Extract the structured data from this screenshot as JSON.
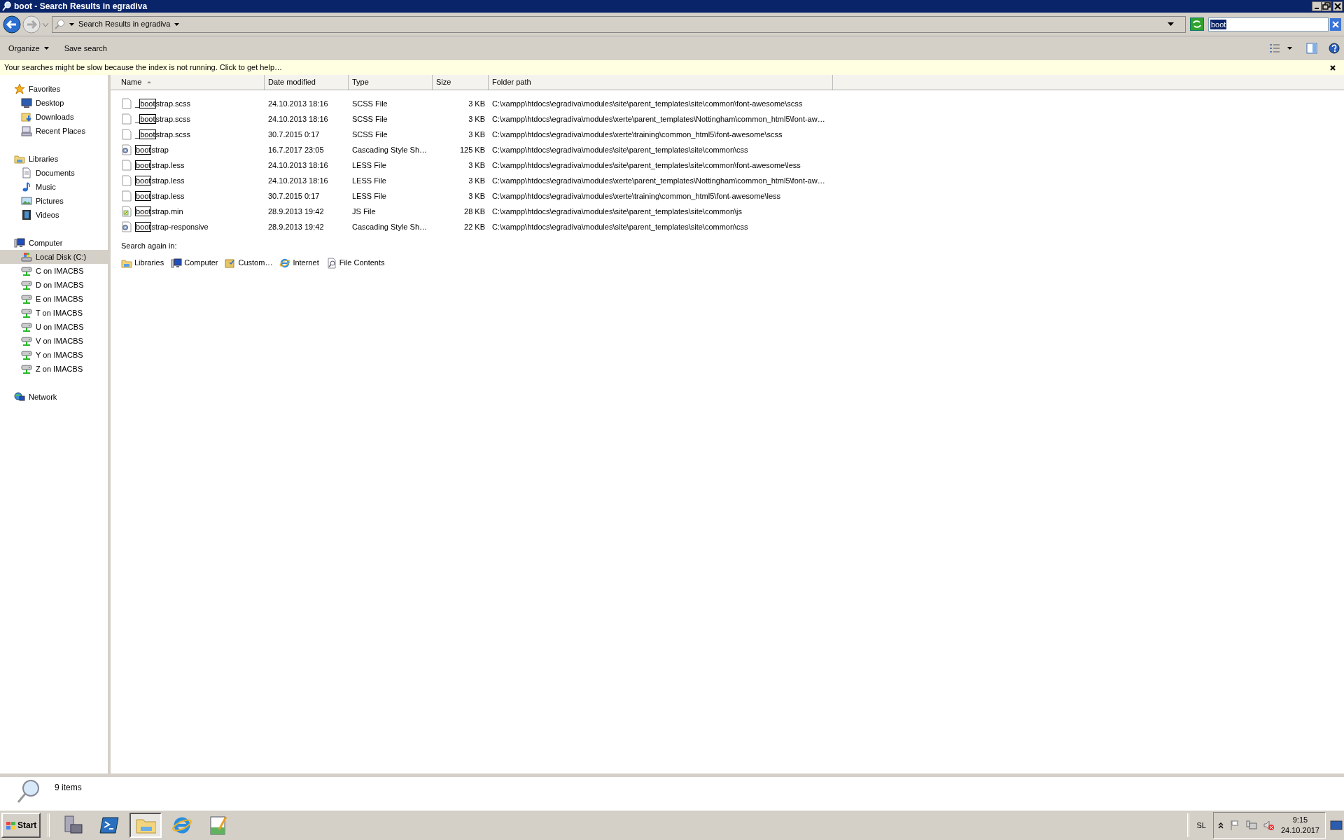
{
  "window": {
    "title": "boot - Search Results in egradiva"
  },
  "address_bar": {
    "breadcrumb": "Search Results in egradiva"
  },
  "search_field": {
    "value": "boot"
  },
  "toolbar": {
    "buttons": [
      {
        "label": "Organize",
        "dropdown": true
      },
      {
        "label": "Save search",
        "dropdown": false
      }
    ]
  },
  "info_bar": {
    "message": "Your searches might be slow because the index is not running. Click to get help…"
  },
  "sidebar": {
    "items": [
      {
        "label": "Favorites",
        "kind": "star",
        "selected": false,
        "children": [
          {
            "label": "Desktop",
            "kind": "desktop",
            "selected": false
          },
          {
            "label": "Downloads",
            "kind": "downloads",
            "selected": false
          },
          {
            "label": "Recent Places",
            "kind": "recent",
            "selected": false
          }
        ]
      },
      {
        "label": "Libraries",
        "kind": "library",
        "selected": false,
        "children": [
          {
            "label": "Documents",
            "kind": "document",
            "selected": false
          },
          {
            "label": "Music",
            "kind": "music",
            "selected": false
          },
          {
            "label": "Pictures",
            "kind": "picture",
            "selected": false
          },
          {
            "label": "Videos",
            "kind": "video",
            "selected": false
          }
        ]
      },
      {
        "label": "Computer",
        "kind": "computer",
        "selected": false,
        "children": [
          {
            "label": "Local Disk (C:)",
            "kind": "disk",
            "selected": true
          },
          {
            "label": "C on IMACBS",
            "kind": "netdrive",
            "selected": false
          },
          {
            "label": "D on IMACBS",
            "kind": "netdrive",
            "selected": false
          },
          {
            "label": "E on IMACBS",
            "kind": "netdrive",
            "selected": false
          },
          {
            "label": "T on IMACBS",
            "kind": "netdrive",
            "selected": false
          },
          {
            "label": "U on IMACBS",
            "kind": "netdrive",
            "selected": false
          },
          {
            "label": "V on IMACBS",
            "kind": "netdrive",
            "selected": false
          },
          {
            "label": "Y on IMACBS",
            "kind": "netdrive",
            "selected": false
          },
          {
            "label": "Z on IMACBS",
            "kind": "netdrive",
            "selected": false
          }
        ]
      },
      {
        "label": "Network",
        "kind": "network",
        "selected": false
      }
    ]
  },
  "columns": [
    {
      "label": "Name",
      "sorted": true
    },
    {
      "label": "Date modified",
      "sorted": false
    },
    {
      "label": "Type",
      "sorted": false
    },
    {
      "label": "Size",
      "sorted": false
    },
    {
      "label": "Folder path",
      "sorted": false
    }
  ],
  "rows": [
    {
      "kind": "blank",
      "name_before": "_",
      "name_match": "boot",
      "name_after": "strap.scss",
      "date": "24.10.2013 18:16",
      "type": "SCSS File",
      "size": "3 KB",
      "folder": "C:\\xampp\\htdocs\\egradiva\\modules\\site\\parent_templates\\site\\common\\font-awesome\\scss"
    },
    {
      "kind": "blank",
      "name_before": "_",
      "name_match": "boot",
      "name_after": "strap.scss",
      "date": "24.10.2013 18:16",
      "type": "SCSS File",
      "size": "3 KB",
      "folder": "C:\\xampp\\htdocs\\egradiva\\modules\\xerte\\parent_templates\\Nottingham\\common_html5\\font-aw…"
    },
    {
      "kind": "blank",
      "name_before": "_",
      "name_match": "boot",
      "name_after": "strap.scss",
      "date": "30.7.2015 0:17",
      "type": "SCSS File",
      "size": "3 KB",
      "folder": "C:\\xampp\\htdocs\\egradiva\\modules\\xerte\\training\\common_html5\\font-awesome\\scss"
    },
    {
      "kind": "stylesheet",
      "name_before": "",
      "name_match": "boot",
      "name_after": "strap",
      "date": "16.7.2017 23:05",
      "type": "Cascading Style Sh…",
      "size": "125 KB",
      "folder": "C:\\xampp\\htdocs\\egradiva\\modules\\site\\parent_templates\\site\\common\\css"
    },
    {
      "kind": "blank",
      "name_before": "",
      "name_match": "boot",
      "name_after": "strap.less",
      "date": "24.10.2013 18:16",
      "type": "LESS File",
      "size": "3 KB",
      "folder": "C:\\xampp\\htdocs\\egradiva\\modules\\site\\parent_templates\\site\\common\\font-awesome\\less"
    },
    {
      "kind": "blank",
      "name_before": "",
      "name_match": "boot",
      "name_after": "strap.less",
      "date": "24.10.2013 18:16",
      "type": "LESS File",
      "size": "3 KB",
      "folder": "C:\\xampp\\htdocs\\egradiva\\modules\\xerte\\parent_templates\\Nottingham\\common_html5\\font-aw…"
    },
    {
      "kind": "blank",
      "name_before": "",
      "name_match": "boot",
      "name_after": "strap.less",
      "date": "30.7.2015 0:17",
      "type": "LESS File",
      "size": "3 KB",
      "folder": "C:\\xampp\\htdocs\\egradiva\\modules\\xerte\\training\\common_html5\\font-awesome\\less"
    },
    {
      "kind": "script",
      "name_before": "",
      "name_match": "boot",
      "name_after": "strap.min",
      "date": "28.9.2013 19:42",
      "type": "JS File",
      "size": "28 KB",
      "folder": "C:\\xampp\\htdocs\\egradiva\\modules\\site\\parent_templates\\site\\common\\js"
    },
    {
      "kind": "stylesheet",
      "name_before": "",
      "name_match": "boot",
      "name_after": "strap-responsive",
      "date": "28.9.2013 19:42",
      "type": "Cascading Style Sh…",
      "size": "22 KB",
      "folder": "C:\\xampp\\htdocs\\egradiva\\modules\\site\\parent_templates\\site\\common\\css"
    }
  ],
  "search_again": {
    "label": "Search again in:",
    "items": [
      {
        "kind": "library",
        "label": "Libraries"
      },
      {
        "kind": "computer",
        "label": "Computer"
      },
      {
        "kind": "custom",
        "label": "Custom…"
      },
      {
        "kind": "internet",
        "label": "Internet"
      },
      {
        "kind": "contents",
        "label": "File Contents"
      }
    ]
  },
  "status": {
    "text": "9 items"
  },
  "taskbar": {
    "start": "Start",
    "apps": [
      {
        "kind": "server",
        "selected": false
      },
      {
        "kind": "shell",
        "selected": false
      },
      {
        "kind": "explorer",
        "selected": true
      },
      {
        "kind": "browser",
        "selected": false
      },
      {
        "kind": "notepad",
        "selected": false
      }
    ],
    "language": "SL",
    "time": "9:15",
    "date": "24.10.2017"
  }
}
